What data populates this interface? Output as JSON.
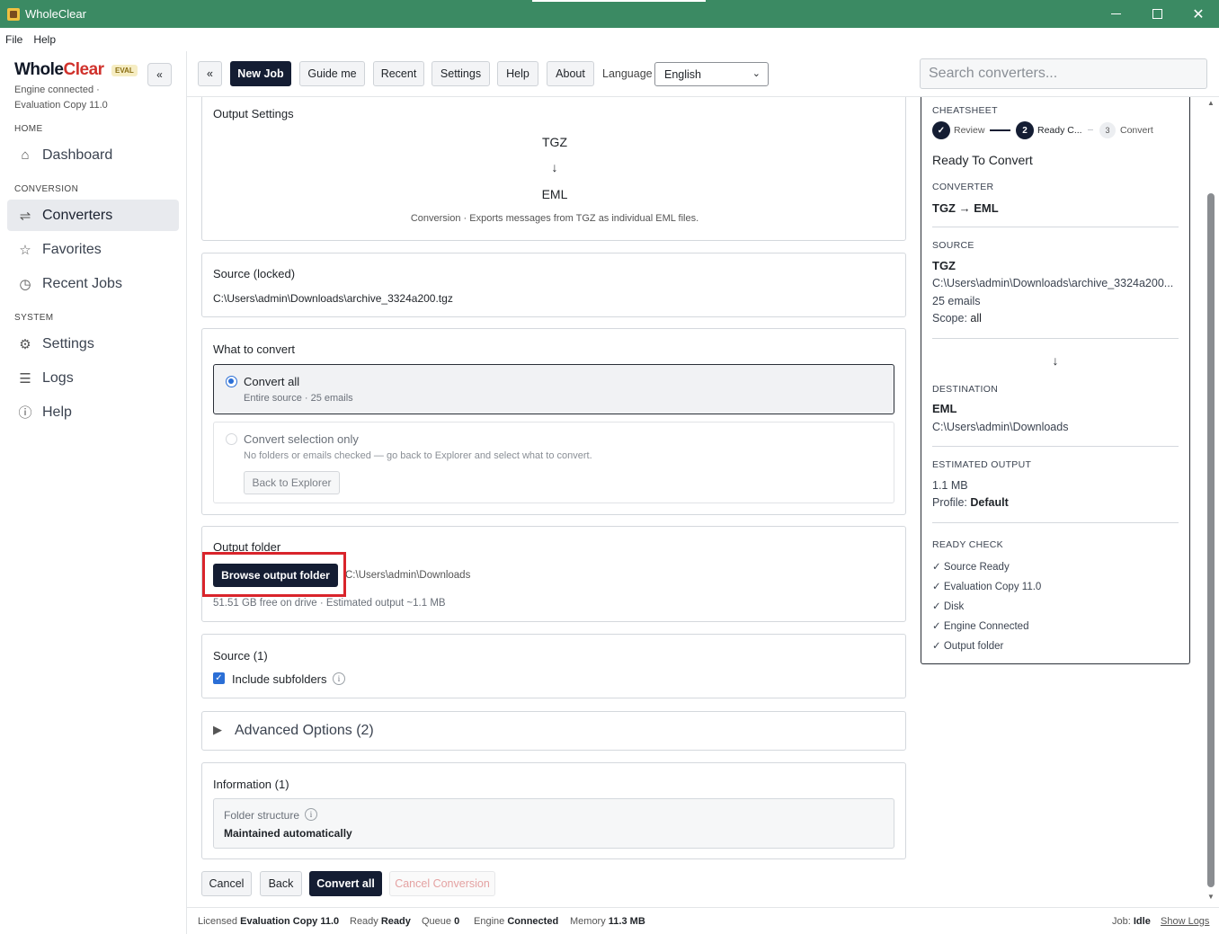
{
  "window": {
    "title": "WholeClear",
    "menu": [
      "File",
      "Help"
    ]
  },
  "sidebar": {
    "brand_whole": "Whole",
    "brand_clear": "Clear",
    "badge": "EVAL",
    "collapse_label": "«",
    "engine_status": "Engine connected · Evaluation Copy 11.0",
    "sections": {
      "home": "HOME",
      "conversion": "CONVERSION",
      "system": "SYSTEM"
    },
    "items": {
      "dashboard": "Dashboard",
      "converters": "Converters",
      "favorites": "Favorites",
      "recent_jobs": "Recent Jobs",
      "settings": "Settings",
      "logs": "Logs",
      "help": "Help"
    },
    "active_item": "Converters"
  },
  "toolbar": {
    "back": "«",
    "new_job": "New Job",
    "guide_me": "Guide me",
    "recent": "Recent",
    "settings": "Settings",
    "help": "Help",
    "about": "About",
    "language_label": "Language",
    "language_value": "English",
    "search_placeholder": "Search converters..."
  },
  "output_settings": {
    "title": "Output Settings",
    "source_format": "TGZ",
    "arrow": "↓",
    "target_format": "EML",
    "description": "Conversion · Exports messages from TGZ as individual EML files."
  },
  "source_locked": {
    "title": "Source (locked)",
    "path": "C:\\Users\\admin\\Downloads\\archive_3324a200.tgz"
  },
  "what_to_convert": {
    "title": "What to convert",
    "convert_all_label": "Convert all",
    "convert_all_sub": "Entire source · 25 emails",
    "selection_label": "Convert selection only",
    "selection_sub": "No folders or emails checked — go back to Explorer and select what to convert.",
    "back_to_explorer": "Back to Explorer"
  },
  "output_folder": {
    "title": "Output folder",
    "browse_button": "Browse output folder",
    "path": "C:\\Users\\admin\\Downloads",
    "info": "51.51 GB free on drive · Estimated output ~1.1 MB"
  },
  "source_section": {
    "title": "Source (1)",
    "include_subfolders": "Include subfolders",
    "include_subfolders_checked": true
  },
  "advanced": {
    "title": "Advanced Options (2)"
  },
  "information": {
    "title": "Information (1)",
    "folder_structure_label": "Folder structure",
    "folder_structure_value": "Maintained automatically"
  },
  "actions": {
    "cancel": "Cancel",
    "back": "Back",
    "convert_all": "Convert all",
    "cancel_conversion": "Cancel Conversion"
  },
  "cheatsheet": {
    "title": "CHEATSHEET",
    "steps": [
      {
        "number": "✓",
        "label": "Review"
      },
      {
        "number": "2",
        "label": "Ready C..."
      },
      {
        "number": "3",
        "label": "Convert"
      }
    ],
    "status_heading": "Ready To Convert",
    "converter_label": "CONVERTER",
    "converter_value": "TGZ → EML",
    "source_label": "SOURCE",
    "source_format": "TGZ",
    "source_path": "C:\\Users\\admin\\Downloads\\archive_3324a200...",
    "source_count": "25 emails",
    "source_scope_label": "Scope:",
    "source_scope_value": "all",
    "arrow": "↓",
    "destination_label": "DESTINATION",
    "destination_format": "EML",
    "destination_path": "C:\\Users\\admin\\Downloads",
    "estimated_label": "ESTIMATED OUTPUT",
    "estimated_size": "1.1 MB",
    "profile_label": "Profile:",
    "profile_value": "Default",
    "ready_check_label": "READY CHECK",
    "checks": [
      "✓ Source Ready",
      "✓ Evaluation Copy 11.0",
      "✓ Disk",
      "✓ Engine Connected",
      "✓ Output folder"
    ]
  },
  "statusbar": {
    "licensed_label": "Licensed",
    "licensed_value": "Evaluation Copy 11.0",
    "ready_label": "Ready",
    "ready_value": "Ready",
    "queue_label": "Queue",
    "queue_value": "0",
    "engine_label": "Engine",
    "engine_value": "Connected",
    "memory_label": "Memory",
    "memory_value": "11.3 MB",
    "job_label": "Job:",
    "job_value": "Idle",
    "show_logs": "Show Logs"
  },
  "colors": {
    "titlebar": "#3b8a63",
    "primary_button": "#141d33",
    "brand_accent": "#d0322c",
    "highlight_box": "#d9242b",
    "radio_accent": "#2b6fd6"
  }
}
